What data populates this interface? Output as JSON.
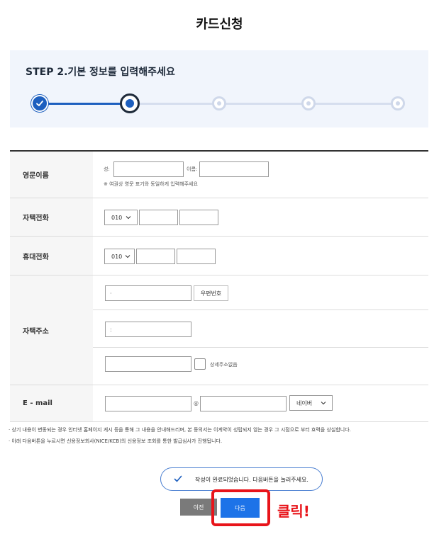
{
  "page": {
    "title": "카드신청"
  },
  "step": {
    "title": "STEP 2.기본 정보를 입력해주세요",
    "total": 5,
    "current": 2
  },
  "form": {
    "english_name": {
      "label": "영문이름",
      "surname_label": "성:",
      "given_name_label": "이름:",
      "note": "※ 여권상 영문 표기와 동일하게 입력해주세요"
    },
    "home_phone": {
      "label": "자택전화",
      "prefix": "010"
    },
    "mobile_phone": {
      "label": "휴대전화",
      "prefix": "010"
    },
    "home_address": {
      "label": "자택주소",
      "line1_value": "·",
      "postal_button": "우편번호",
      "line2_value": ":",
      "no_detail_label": "상세주소없음"
    },
    "email": {
      "label": "E - mail",
      "at": "@",
      "domain_option": "네이버"
    }
  },
  "notices": [
    "상기 내용이 변동되는 경우 인터넷 홈페이지 게시 등을 통해 그 내용을 안내해드리며, 본 동의서는 이계약이 성립되지 않는 경우 그 시점으로 부터 효력을 상실합니다.",
    "아래 다음버튼을 누르시면 신용정보회사(NICE/KCB)의 신용정보 조회를 통한 발급심사가 진행됩니다."
  ],
  "toast": {
    "message": "작성이 완료되었습니다. 다음버튼을 눌러주세요."
  },
  "buttons": {
    "prev": "이전",
    "next": "다음"
  },
  "annotation": {
    "text": "클릭!"
  },
  "colors": {
    "accent": "#1d5fbf",
    "next_button": "#1d73e8",
    "annotation": "#e8141a"
  }
}
